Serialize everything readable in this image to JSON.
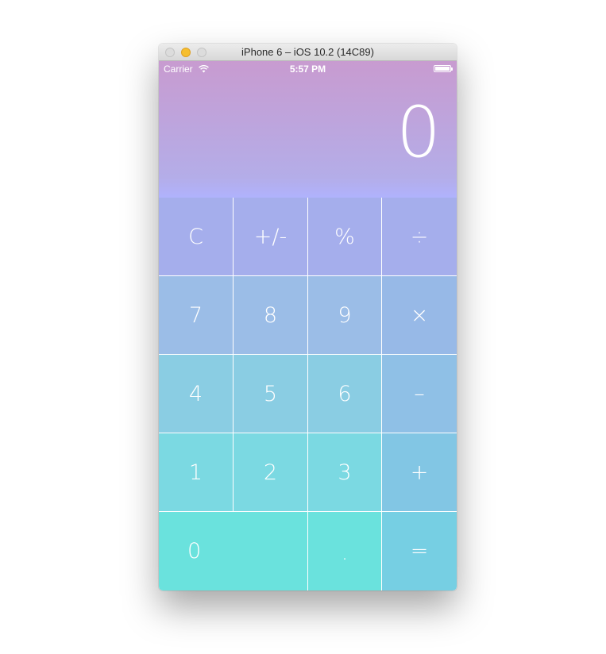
{
  "window": {
    "title": "iPhone 6 – iOS 10.2 (14C89)"
  },
  "status_bar": {
    "carrier": "Carrier",
    "time": "5:57 PM",
    "icons": [
      "wifi-icon",
      "battery-icon"
    ]
  },
  "display": {
    "value": "0"
  },
  "keypad": {
    "rows": [
      [
        {
          "name": "clear-button",
          "label": "C",
          "color": "#a5aeec"
        },
        {
          "name": "sign-toggle-button",
          "label": "+/-",
          "color": "#a5aeec"
        },
        {
          "name": "percent-button",
          "label": "%",
          "color": "#a5aeec"
        },
        {
          "name": "divide-button",
          "label": "÷",
          "color": "#a5aeec"
        }
      ],
      [
        {
          "name": "digit-7-button",
          "label": "7",
          "color": "#9bbde7"
        },
        {
          "name": "digit-8-button",
          "label": "8",
          "color": "#9bbde7"
        },
        {
          "name": "digit-9-button",
          "label": "9",
          "color": "#9bbde7"
        },
        {
          "name": "multiply-button",
          "label": "×",
          "color": "#97b9e7"
        }
      ],
      [
        {
          "name": "digit-4-button",
          "label": "4",
          "color": "#8acde3"
        },
        {
          "name": "digit-5-button",
          "label": "5",
          "color": "#8acde3"
        },
        {
          "name": "digit-6-button",
          "label": "6",
          "color": "#8acde3"
        },
        {
          "name": "minus-button",
          "label": "–",
          "color": "#8fc0e6"
        }
      ],
      [
        {
          "name": "digit-1-button",
          "label": "1",
          "color": "#7bd9e2"
        },
        {
          "name": "digit-2-button",
          "label": "2",
          "color": "#7bd9e2"
        },
        {
          "name": "digit-3-button",
          "label": "3",
          "color": "#7bd9e2"
        },
        {
          "name": "plus-button",
          "label": "+",
          "color": "#82c6e4"
        }
      ],
      [
        {
          "name": "digit-0-button",
          "label": "0",
          "color": "#6ae2dd",
          "span": 2
        },
        {
          "name": "decimal-button",
          "label": ".",
          "color": "#6ae2dd"
        },
        {
          "name": "equals-button",
          "label": "=",
          "color": "#76cfe3"
        }
      ]
    ]
  }
}
